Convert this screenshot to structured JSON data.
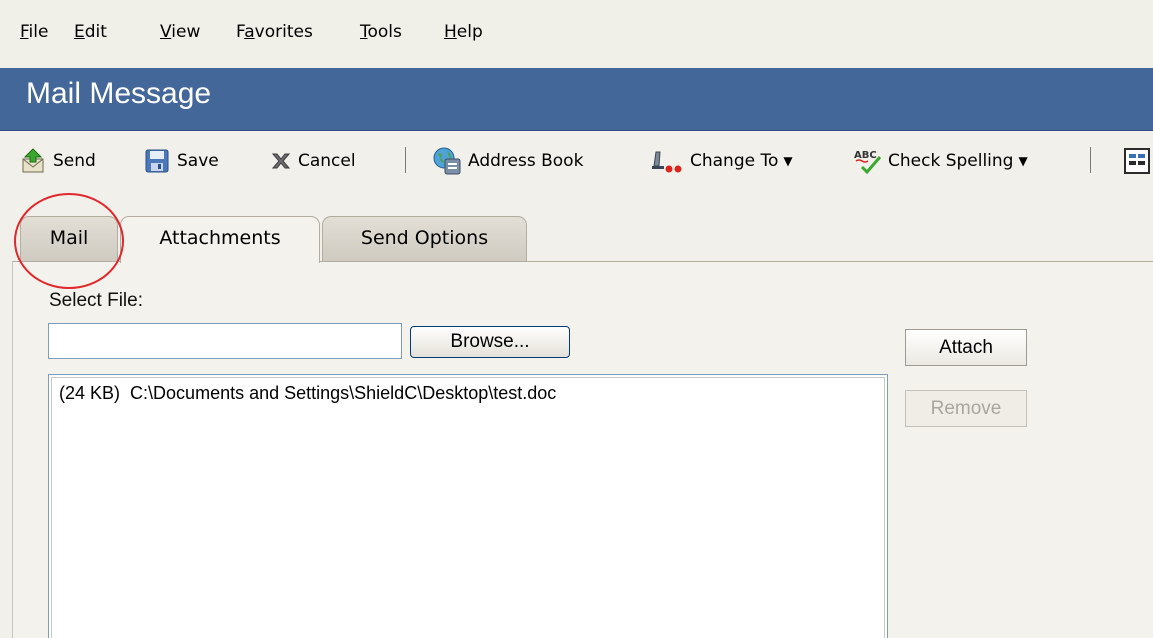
{
  "menu": {
    "items": [
      "File",
      "Edit",
      "View",
      "Favorites",
      "Tools",
      "Help"
    ],
    "accelerators": [
      "F",
      "E",
      "V",
      "a",
      "T",
      "H"
    ]
  },
  "window": {
    "title": "Mail Message",
    "header_color": "#446799"
  },
  "toolbar": {
    "send": {
      "label": "Send",
      "icon": "send-envelope-icon"
    },
    "save": {
      "label": "Save",
      "icon": "floppy-disk-icon"
    },
    "cancel": {
      "label": "Cancel",
      "icon": "x-cancel-icon"
    },
    "address_book": {
      "label": "Address Book",
      "icon": "globe-address-book-icon"
    },
    "change_to": {
      "label": "Change To",
      "icon": "change-to-icon"
    },
    "check_spelling": {
      "label": "Check Spelling",
      "icon": "abc-spellcheck-icon"
    }
  },
  "tabs": [
    {
      "label": "Mail",
      "active": false
    },
    {
      "label": "Attachments",
      "active": true
    },
    {
      "label": "Send Options",
      "active": false
    }
  ],
  "attachments": {
    "select_file_label": "Select File:",
    "file_input_value": "",
    "browse_label": "Browse...",
    "attach_label": "Attach",
    "remove_label": "Remove",
    "files": [
      {
        "size": "(24 KB)",
        "path": "C:\\Documents and Settings\\ShieldC\\Desktop\\test.doc"
      }
    ]
  },
  "colors": {
    "callout": "#e0282d",
    "header": "#446799"
  }
}
